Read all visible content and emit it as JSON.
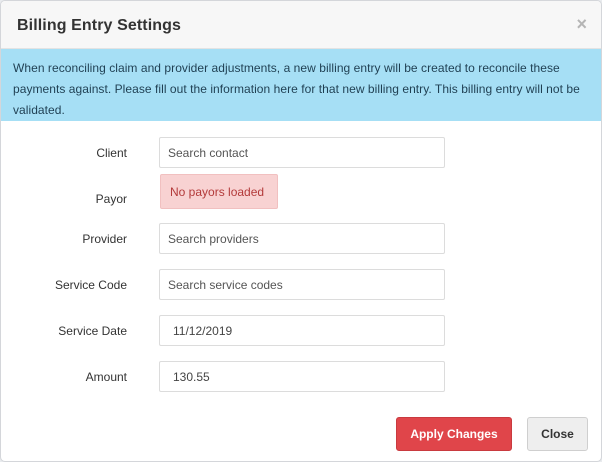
{
  "modal": {
    "title": "Billing Entry Settings",
    "close_glyph": "×"
  },
  "info_message": "When reconciling claim and provider adjustments, a new billing entry will be created to reconcile these payments against. Please fill out the information here for that new billing entry. This billing entry will not be validated.",
  "form": {
    "client": {
      "label": "Client",
      "placeholder": "Search contact"
    },
    "payor": {
      "label": "Payor",
      "status": "No payors loaded"
    },
    "provider": {
      "label": "Provider",
      "placeholder": "Search providers"
    },
    "service_code": {
      "label": "Service Code",
      "placeholder": "Search service codes"
    },
    "service_date": {
      "label": "Service Date",
      "value": "11/12/2019"
    },
    "amount": {
      "label": "Amount",
      "value": "130.55"
    }
  },
  "buttons": {
    "apply": "Apply Changes",
    "close": "Close"
  },
  "colors": {
    "info_bg": "#a6dff5",
    "danger_bg": "#f8d2d2",
    "primary_button": "#e0454a"
  }
}
